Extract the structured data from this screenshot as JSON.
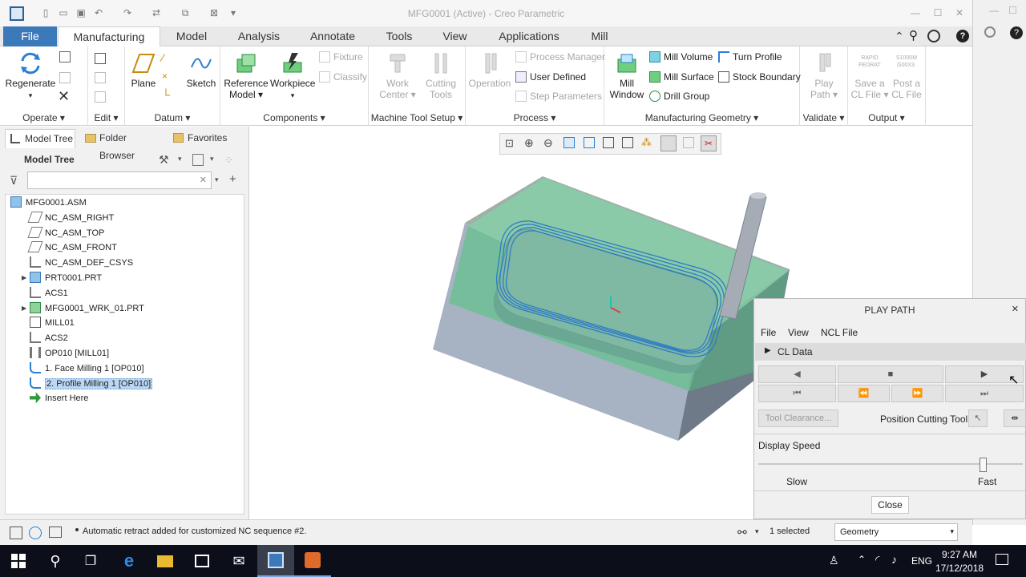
{
  "window": {
    "title": "MFG0001 (Active) - Creo Parametric"
  },
  "menubar": {
    "tabs": [
      "File",
      "Manufacturing",
      "Model",
      "Analysis",
      "Annotate",
      "Tools",
      "View",
      "Applications",
      "Mill"
    ],
    "active": "Manufacturing"
  },
  "ribbon": {
    "operate": {
      "regenerate": "Regenerate",
      "label": "Operate"
    },
    "edit": {
      "label": "Edit"
    },
    "datum": {
      "plane": "Plane",
      "sketch": "Sketch",
      "label": "Datum"
    },
    "components": {
      "reference_model_l1": "Reference",
      "reference_model_l2": "Model",
      "workpiece": "Workpiece",
      "label": "Components"
    },
    "machine_tool_setup": {
      "fixture": "Fixture",
      "classify": "Classify",
      "work_center_l1": "Work",
      "work_center_l2": "Center",
      "cutting_tools_l1": "Cutting",
      "cutting_tools_l2": "Tools",
      "label": "Machine Tool Setup"
    },
    "process": {
      "operation": "Operation",
      "process_manager": "Process Manager",
      "user_defined": "User Defined",
      "step_parameters": "Step Parameters",
      "label": "Process"
    },
    "mfg_geometry": {
      "mill_window_l1": "Mill",
      "mill_window_l2": "Window",
      "mill_volume": "Mill Volume",
      "mill_surface": "Mill Surface",
      "drill_group": "Drill Group",
      "turn_profile": "Turn Profile",
      "stock_boundary": "Stock Boundary",
      "label": "Manufacturing Geometry"
    },
    "validate": {
      "play_path_l1": "Play",
      "play_path_l2": "Path",
      "label": "Validate"
    },
    "output": {
      "save_cl_l1": "Save a",
      "save_cl_l2": "CL File",
      "post_cl_l1": "Post a",
      "post_cl_l2": "CL File",
      "rapid_icon_text_1": "RAPID",
      "rapid_icon_text_2": "FEDRAT",
      "post_icon_text_1": "S1000M",
      "post_icon_text_2": "G00X3.",
      "label": "Output"
    }
  },
  "left_panel": {
    "tabs": [
      "Model Tree",
      "Folder Browser",
      "Favorites"
    ],
    "header": "Model Tree",
    "filter_placeholder": "",
    "tree": [
      {
        "label": "MFG0001.ASM",
        "icon": "assembly-icon",
        "indent": 0,
        "expand": ""
      },
      {
        "label": "NC_ASM_RIGHT",
        "icon": "datum-plane-icon",
        "indent": 1,
        "expand": ""
      },
      {
        "label": "NC_ASM_TOP",
        "icon": "datum-plane-icon",
        "indent": 1,
        "expand": ""
      },
      {
        "label": "NC_ASM_FRONT",
        "icon": "datum-plane-icon",
        "indent": 1,
        "expand": ""
      },
      {
        "label": "NC_ASM_DEF_CSYS",
        "icon": "csys-icon",
        "indent": 1,
        "expand": ""
      },
      {
        "label": "PRT0001.PRT",
        "icon": "part-icon",
        "indent": 1,
        "expand": "▶"
      },
      {
        "label": "ACS1",
        "icon": "csys-icon",
        "indent": 1,
        "expand": ""
      },
      {
        "label": "MFG0001_WRK_01.PRT",
        "icon": "workpiece-icon",
        "indent": 1,
        "expand": "▶"
      },
      {
        "label": "MILL01",
        "icon": "mill-icon",
        "indent": 1,
        "expand": ""
      },
      {
        "label": "ACS2",
        "icon": "csys-icon",
        "indent": 1,
        "expand": ""
      },
      {
        "label": "OP010 [MILL01]",
        "icon": "operation-icon",
        "indent": 1,
        "expand": ""
      },
      {
        "label": "1. Face Milling 1 [OP010]",
        "icon": "sequence-icon",
        "indent": 1,
        "expand": ""
      },
      {
        "label": "2. Profile Milling 1 [OP010]",
        "icon": "sequence-icon",
        "indent": 1,
        "expand": "",
        "selected": true
      },
      {
        "label": "Insert Here",
        "icon": "insert-arrow-icon",
        "indent": 1,
        "expand": ""
      }
    ]
  },
  "play_path": {
    "title": "PLAY PATH",
    "menu": [
      "File",
      "View",
      "NCL File"
    ],
    "cl_data": "CL Data",
    "tool_clearance": "Tool Clearance...",
    "position_cutting_tool": "Position Cutting Tool",
    "display_speed": "Display Speed",
    "slow": "Slow",
    "fast": "Fast",
    "close": "Close"
  },
  "status": {
    "message": "Automatic retract added for customized NC sequence #2.",
    "selected": "1 selected",
    "filter": "Geometry"
  },
  "taskbar": {
    "time": "9:27 AM",
    "date": "17/12/2018",
    "lang": "ENG"
  },
  "colors": {
    "accent": "#3c79b9",
    "workpiece": "#7fc9a0",
    "part": "#9aa6b6",
    "toolpath": "#2a78c8"
  }
}
